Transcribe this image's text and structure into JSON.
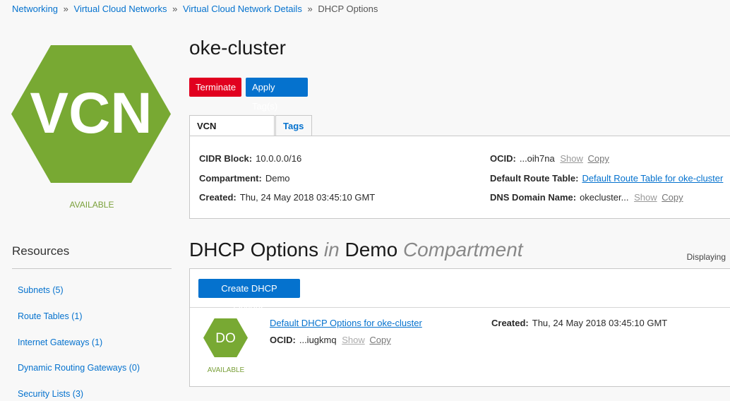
{
  "breadcrumb": {
    "items": [
      "Networking",
      "Virtual Cloud Networks",
      "Virtual Cloud Network Details"
    ],
    "separator": "»",
    "current": "DHCP Options"
  },
  "vcn": {
    "badge_text": "VCN",
    "status": "AVAILABLE",
    "badge_color": "#78a933"
  },
  "page": {
    "title": "oke-cluster",
    "terminate_label": "Terminate",
    "apply_tags_label": "Apply Tag(s)"
  },
  "tabs": {
    "info_label": "VCN Information",
    "tags_label": "Tags"
  },
  "info": {
    "cidr_label": "CIDR Block:",
    "cidr_value": "10.0.0.0/16",
    "compartment_label": "Compartment:",
    "compartment_value": "Demo",
    "created_label": "Created:",
    "created_value": "Thu, 24 May 2018 03:45:10 GMT",
    "ocid_label": "OCID:",
    "ocid_value": "...oih7na",
    "show_label": "Show",
    "copy_label": "Copy",
    "route_table_label": "Default Route Table:",
    "route_table_value": "Default Route Table for oke-cluster",
    "dns_label": "DNS Domain Name:",
    "dns_value": "okecluster..."
  },
  "resources": {
    "title": "Resources",
    "items": [
      "Subnets (5)",
      "Route Tables (1)",
      "Internet Gateways (1)",
      "Dynamic Routing Gateways (0)",
      "Security Lists (3)"
    ]
  },
  "dhcp": {
    "title": "DHCP Options",
    "in_word": "in",
    "compartment_name": "Demo",
    "compartment_word": "Compartment",
    "displaying": "Displaying",
    "create_label": "Create DHCP Options",
    "item": {
      "badge_text": "DO",
      "status": "AVAILABLE",
      "name": "Default DHCP Options for oke-cluster",
      "ocid_label": "OCID:",
      "ocid_value": "...iugkmq",
      "show_label": "Show",
      "copy_label": "Copy",
      "created_label": "Created:",
      "created_value": "Thu, 24 May 2018 03:45:10 GMT"
    }
  }
}
